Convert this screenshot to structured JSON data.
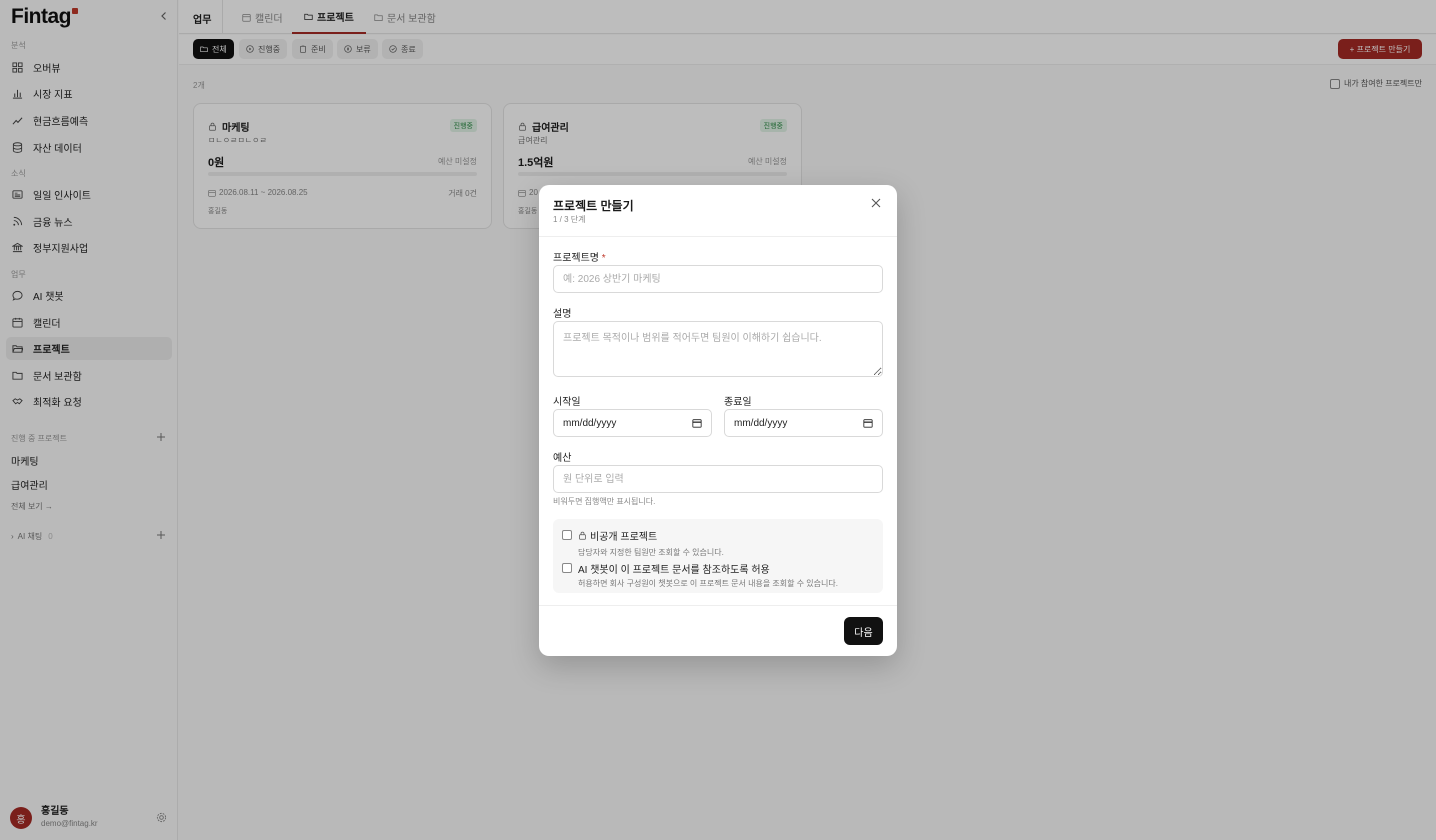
{
  "sidebar": {
    "logo": "Fintag",
    "sections": {
      "analysis": "분석",
      "news": "소식",
      "work": "업무",
      "active_projects": "진행 중 프로젝트",
      "ai_chat": "AI 채팅"
    },
    "items": {
      "overview": "오버뷰",
      "market": "시장 지표",
      "cashflow": "현금흐름예측",
      "assets": "자산 데이터",
      "insight": "일일 인사이트",
      "finance_news": "금융 뉴스",
      "gov": "정부지원사업",
      "ai_chatbot": "AI 챗봇",
      "calendar": "캘린더",
      "project": "프로젝트",
      "docs": "문서 보관함",
      "optimize": "최적화 요청"
    },
    "projects": [
      "마케팅",
      "급여관리"
    ],
    "view_all": "전체 보기 →",
    "ai_chat_count": "0",
    "user": {
      "initial": "홍",
      "name": "홍길동",
      "email": "demo@fintag.kr"
    }
  },
  "topbar": {
    "crumb": "업무",
    "tabs": {
      "calendar": "캘린더",
      "project": "프로젝트",
      "docs": "문서 보관함"
    }
  },
  "filters": {
    "all": "전체",
    "progress": "진행중",
    "ready": "준비",
    "hold": "보류",
    "done": "종료"
  },
  "new_project_button": "+ 프로젝트 만들기",
  "count": "2개",
  "mine_label": "내가 참여한 프로젝트만",
  "cards": [
    {
      "title": "마케팅",
      "subtitle": "ㅁㄴㅇㄹㅁㄴㅇㄹ",
      "status": "진행중",
      "amount": "0원",
      "budget": "예산 미설정",
      "progress": 0,
      "date": "2026.08.11 ~ 2026.08.25",
      "trans": "거래 0건",
      "owner": "홍길동"
    },
    {
      "title": "급여관리",
      "subtitle": "급여관리",
      "status": "진행중",
      "amount": "1.5억원",
      "budget": "예산 미설정",
      "progress": 0,
      "date": "20",
      "trans": "",
      "owner": "홍길동"
    }
  ],
  "modal": {
    "title": "프로젝트 만들기",
    "step": "1 / 3 단계",
    "name_label": "프로젝트명",
    "required_mark": "*",
    "name_placeholder": "예: 2026 상반기 마케팅",
    "desc_label": "설명",
    "desc_placeholder": "프로젝트 목적이나 범위를 적어두면 팀원이 이해하기 쉽습니다.",
    "start_label": "시작일",
    "end_label": "종료일",
    "date_placeholder": "mm/dd/yyyy",
    "budget_label": "예산",
    "budget_placeholder": "원 단위로 입력",
    "budget_hint": "비워두면 집행액만 표시됩니다.",
    "private_title": "비공개 프로젝트",
    "private_desc": "담당자와 지정한 팀원만 조회할 수 있습니다.",
    "ai_title": "AI 챗봇이 이 프로젝트 문서를 참조하도록 허용",
    "ai_desc": "허용하면 회사 구성원이 챗봇으로 이 프로젝트 문서 내용을 조회할 수 있습니다.",
    "next_button": "다음"
  },
  "colors": {
    "brand": "#a52b25",
    "status_green": "#2e8b47"
  }
}
